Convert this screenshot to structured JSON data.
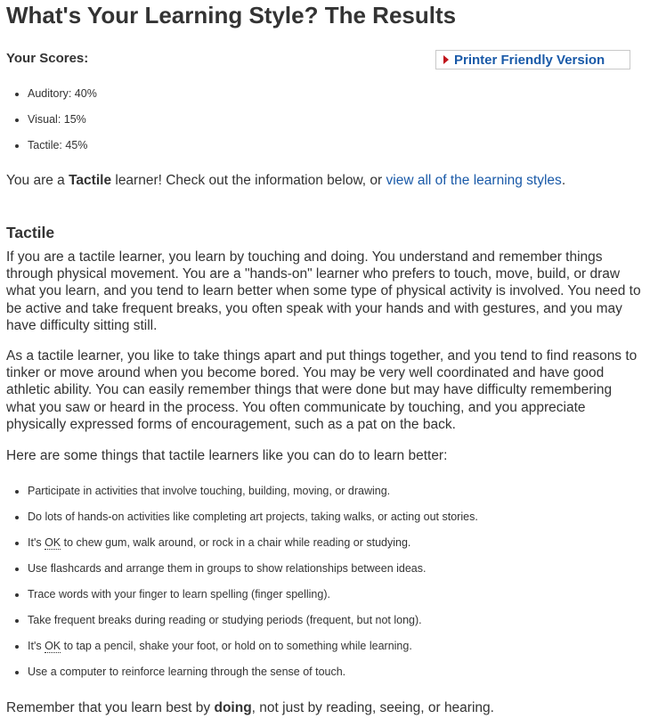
{
  "title": "What's Your Learning Style? The Results",
  "scores_label": "Your Scores:",
  "printer_button": "Printer Friendly Version",
  "scores": [
    {
      "text": "Auditory: 40%"
    },
    {
      "text": "Visual: 15%"
    },
    {
      "text": "Tactile: 45%"
    }
  ],
  "summary": {
    "prefix": "You are a ",
    "style": "Tactile",
    "middle": " learner! Check out the information below, or ",
    "link": "view all of the learning styles",
    "suffix": "."
  },
  "section_title": "Tactile",
  "paragraphs": {
    "p1": "If you are a tactile learner, you learn by touching and doing. You understand and remember things through physical movement. You are a \"hands-on\" learner who prefers to touch, move, build, or draw what you learn, and you tend to learn better when some type of physical activity is involved. You need to be active and take frequent breaks, you often speak with your hands and with gestures, and you may have difficulty sitting still.",
    "p2": "As a tactile learner, you like to take things apart and put things together, and you tend to find reasons to tinker or move around when you become bored. You may be very well coordinated and have good athletic ability. You can easily remember things that were done but may have difficulty remembering what you saw or heard in the process. You often communicate by touching, and you appreciate physically expressed forms of encouragement, such as a pat on the back.",
    "intro": "Here are some things that tactile learners like you can do to learn better:"
  },
  "tips": [
    {
      "before": "Participate in activities that involve touching, building, moving, or drawing.",
      "abbr": "",
      "after": ""
    },
    {
      "before": "Do lots of hands-on activities like completing art projects, taking walks, or acting out stories.",
      "abbr": "",
      "after": ""
    },
    {
      "before": "It's ",
      "abbr": "OK",
      "after": " to chew gum, walk around, or rock in a chair while reading or studying."
    },
    {
      "before": "Use flashcards and arrange them in groups to show relationships between ideas.",
      "abbr": "",
      "after": ""
    },
    {
      "before": "Trace words with your finger to learn spelling (finger spelling).",
      "abbr": "",
      "after": ""
    },
    {
      "before": "Take frequent breaks during reading or studying periods (frequent, but not long).",
      "abbr": "",
      "after": ""
    },
    {
      "before": "It's ",
      "abbr": "OK",
      "after": " to tap a pencil, shake your foot, or hold on to something while learning."
    },
    {
      "before": "Use a computer to reinforce learning through the sense of touch.",
      "abbr": "",
      "after": ""
    }
  ],
  "closing": {
    "prefix": "Remember that you learn best by ",
    "bold": "doing",
    "suffix": ", not just by reading, seeing, or hearing."
  },
  "colors": {
    "link": "#1a5aa8",
    "arrow": "#c0141b",
    "text": "#333333"
  }
}
